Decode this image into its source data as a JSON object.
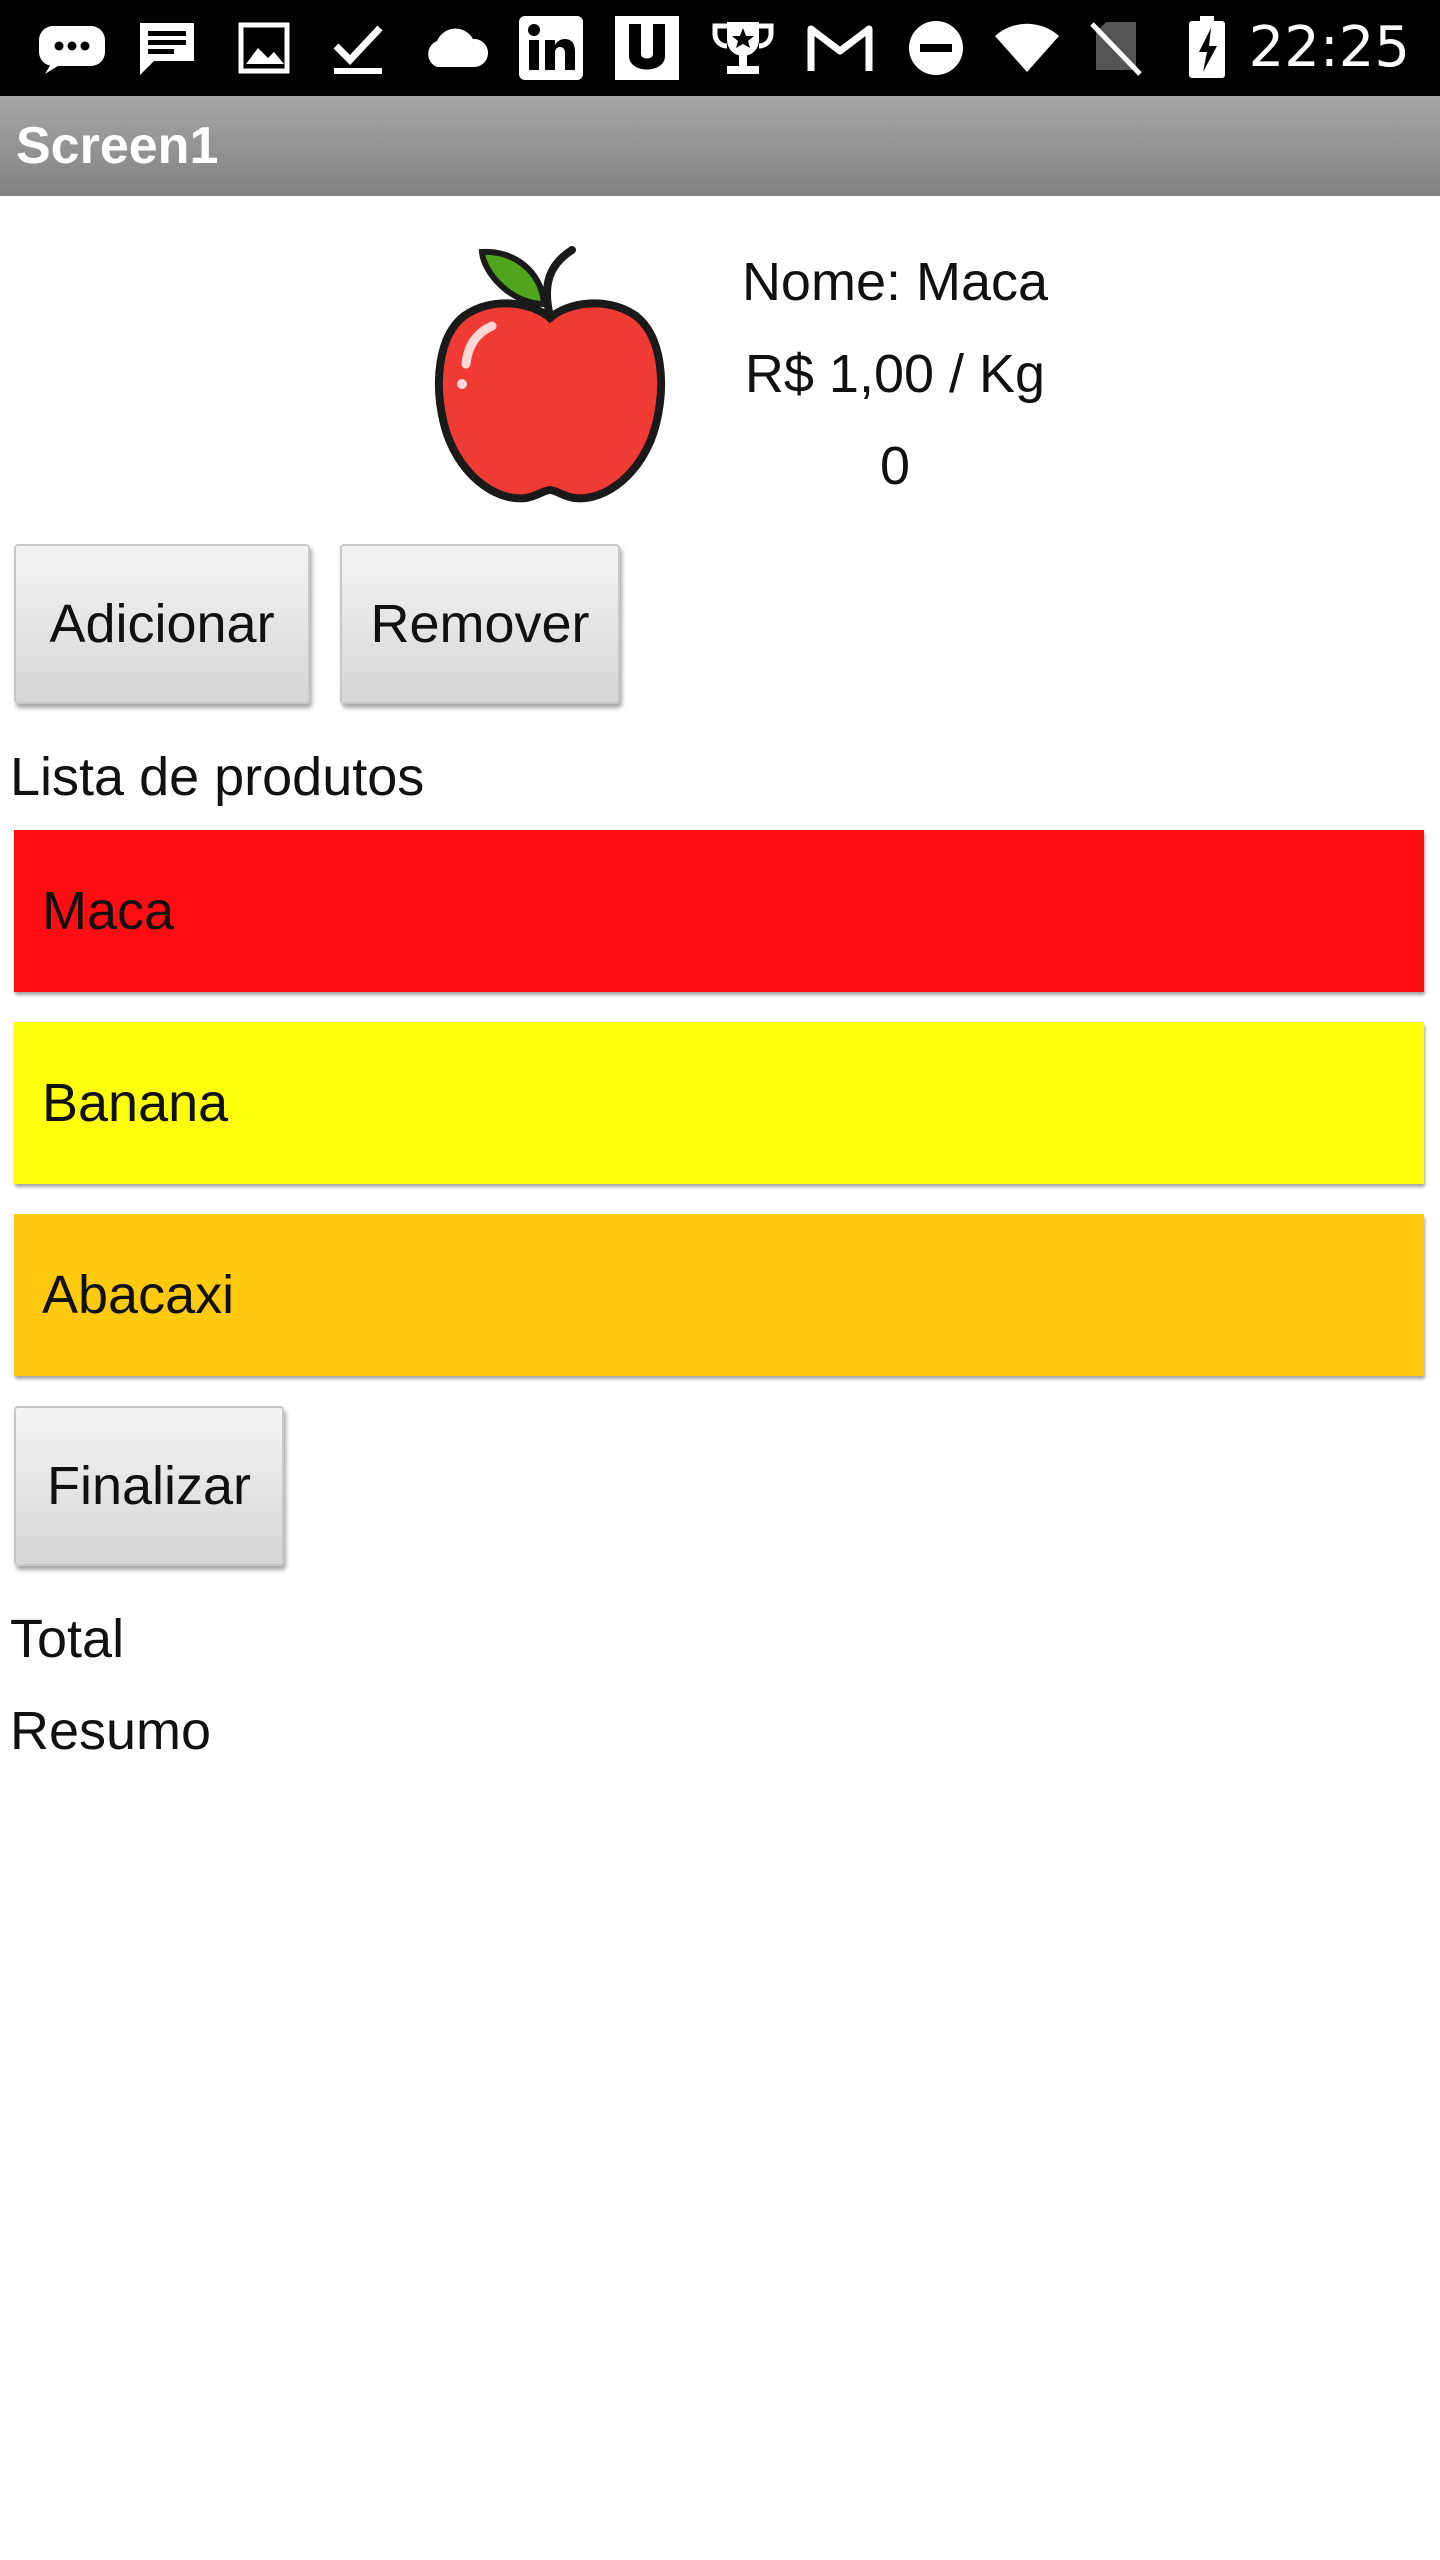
{
  "status_bar": {
    "time": "22:25",
    "icons": [
      "messaging-icon",
      "chat-icon",
      "image-icon",
      "download-done-icon",
      "cloud-icon",
      "linkedin-icon",
      "u-app-icon",
      "trophy-icon",
      "gmail-icon",
      "do-not-disturb-icon",
      "wifi-icon",
      "no-sim-icon",
      "battery-charging-icon"
    ]
  },
  "app_bar": {
    "title": "Screen1"
  },
  "product": {
    "image_icon": "apple-icon",
    "name": "Nome: Maca",
    "price": "R$ 1,00 / Kg",
    "quantity": "0"
  },
  "actions": {
    "add_label": "Adicionar",
    "remove_label": "Remover"
  },
  "list": {
    "header": "Lista de produtos",
    "items": [
      {
        "label": "Maca",
        "color": "#ff0d12"
      },
      {
        "label": "Banana",
        "color": "#ffff0d"
      },
      {
        "label": "Abacaxi",
        "color": "#ffc90e"
      }
    ]
  },
  "finish": {
    "label": "Finalizar"
  },
  "summary": {
    "total_label": "Total",
    "resumo_label": "Resumo"
  }
}
